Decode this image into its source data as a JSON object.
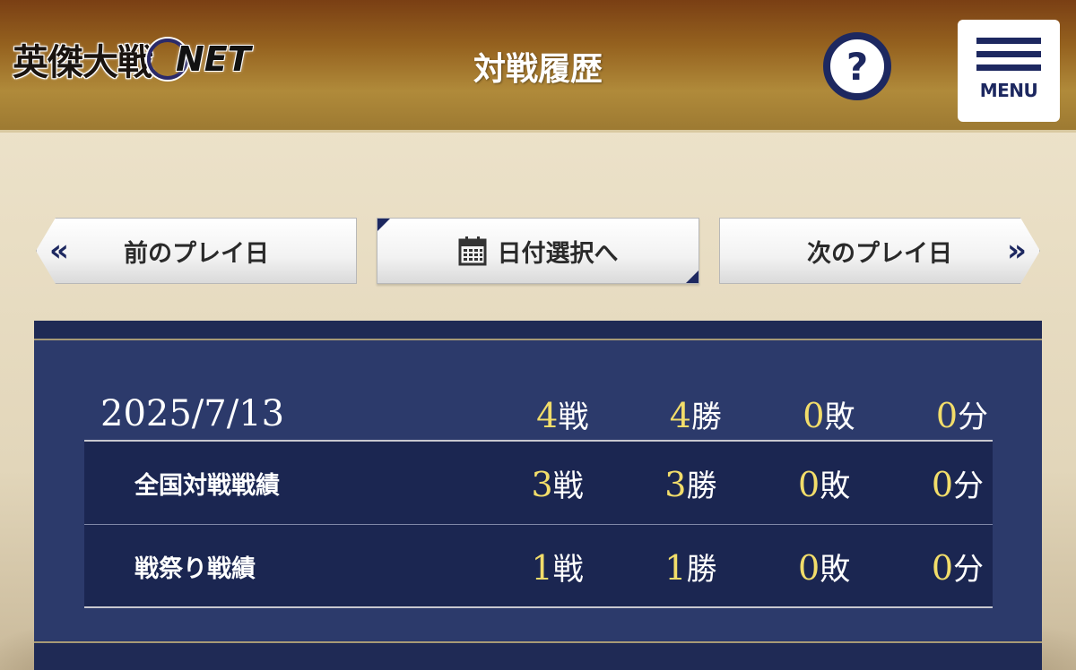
{
  "header": {
    "logo_text": "英傑大戦",
    "logo_suffix": "NET",
    "title": "対戦履歴",
    "help_label": "?",
    "menu_label": "MENU"
  },
  "nav": {
    "prev_label": "前のプレイ日",
    "date_select_label": "日付選択へ",
    "next_label": "次のプレイ日"
  },
  "summary": {
    "date": "2025/7/13",
    "battles": "4",
    "battles_unit": "戦",
    "wins": "4",
    "wins_unit": "勝",
    "losses": "0",
    "losses_unit": "敗",
    "draws": "0",
    "draws_unit": "分"
  },
  "rows": [
    {
      "label": "全国対戦戦績",
      "battles": "3",
      "battles_unit": "戦",
      "wins": "3",
      "wins_unit": "勝",
      "losses": "0",
      "losses_unit": "敗",
      "draws": "0",
      "draws_unit": "分"
    },
    {
      "label": "戦祭り戦績",
      "battles": "1",
      "battles_unit": "戦",
      "wins": "1",
      "wins_unit": "勝",
      "losses": "0",
      "losses_unit": "敗",
      "draws": "0",
      "draws_unit": "分"
    }
  ],
  "colors": {
    "header_brown": "#95621f",
    "navy": "#1d2860",
    "panel_navy": "#2c3a6b",
    "number_yellow": "#f2dd6a"
  },
  "icons": {
    "prev": "double-chevron-left-icon",
    "next": "double-chevron-right-icon",
    "calendar": "calendar-icon",
    "help": "question-icon",
    "menu": "hamburger-icon"
  }
}
